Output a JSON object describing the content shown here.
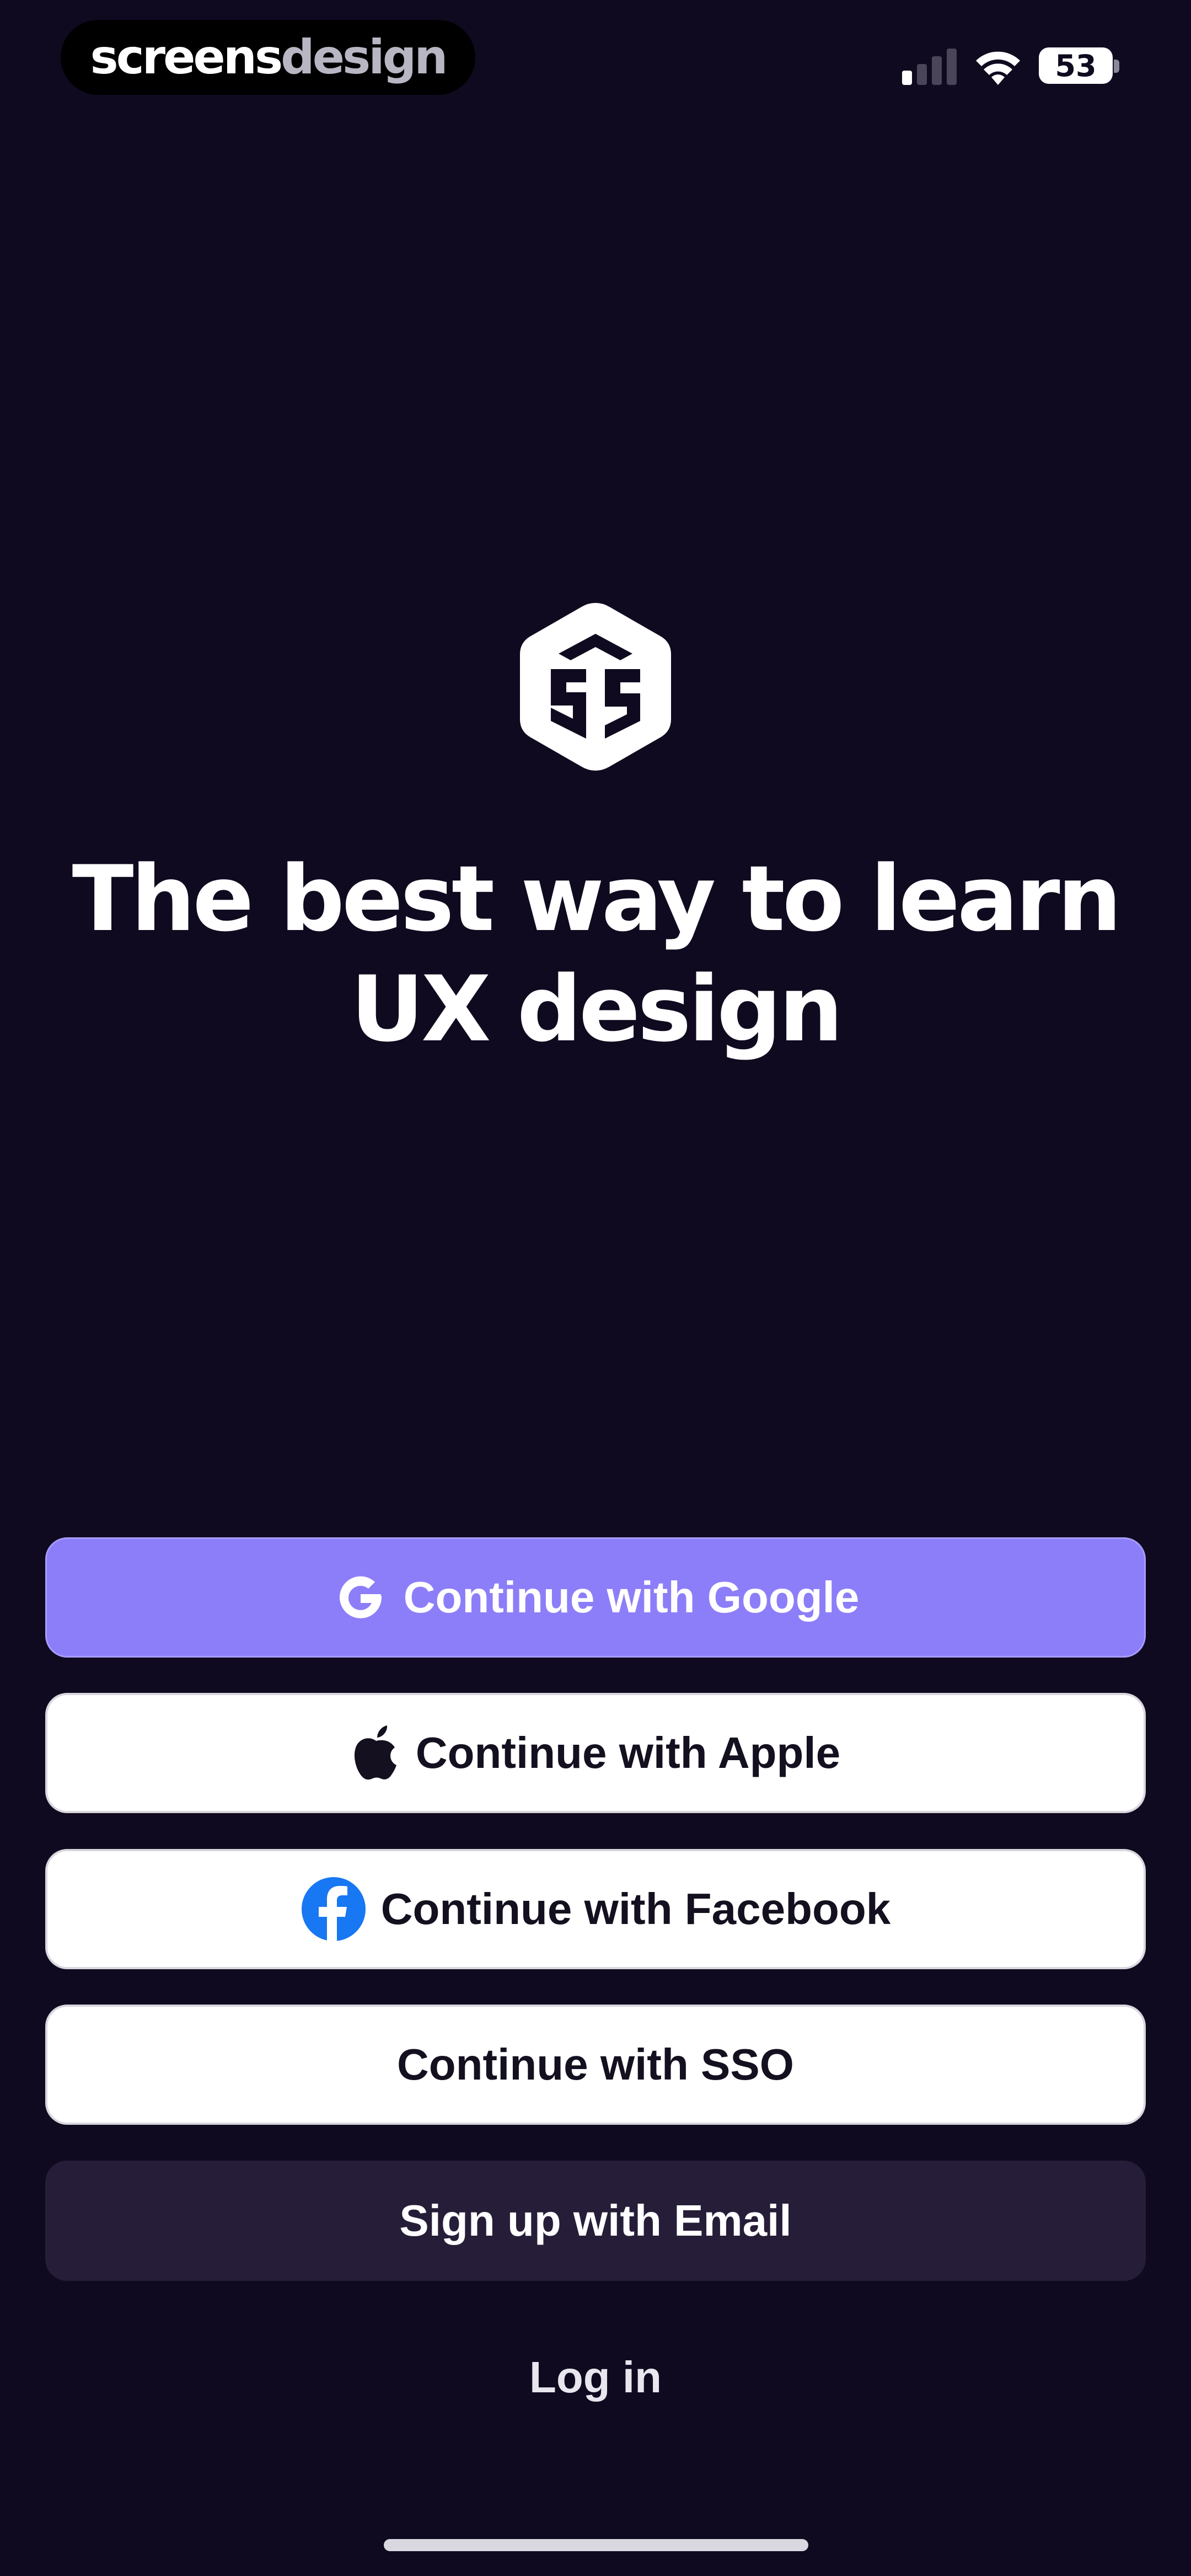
{
  "status_bar": {
    "brand_part_a": "screens",
    "brand_part_b": "design",
    "battery_level": "53",
    "signal_bars_filled": 1,
    "signal_bars_total": 4
  },
  "hero": {
    "logo_icon": "hexagon-brand-logo-icon",
    "headline_line1": "The best way to learn",
    "headline_line2": "UX design"
  },
  "auth": {
    "google_label": "Continue with Google",
    "google_icon": "google-icon",
    "apple_label": "Continue with Apple",
    "apple_icon": "apple-icon",
    "facebook_label": "Continue with Facebook",
    "facebook_icon": "facebook-icon",
    "sso_label": "Continue with SSO",
    "email_label": "Sign up with Email",
    "login_label": "Log in"
  },
  "colors": {
    "background": "#100a20",
    "google_button": "#8c7ef9",
    "light_button": "#ffffff",
    "email_button": "#261e38",
    "facebook_blue": "#1877f2"
  }
}
